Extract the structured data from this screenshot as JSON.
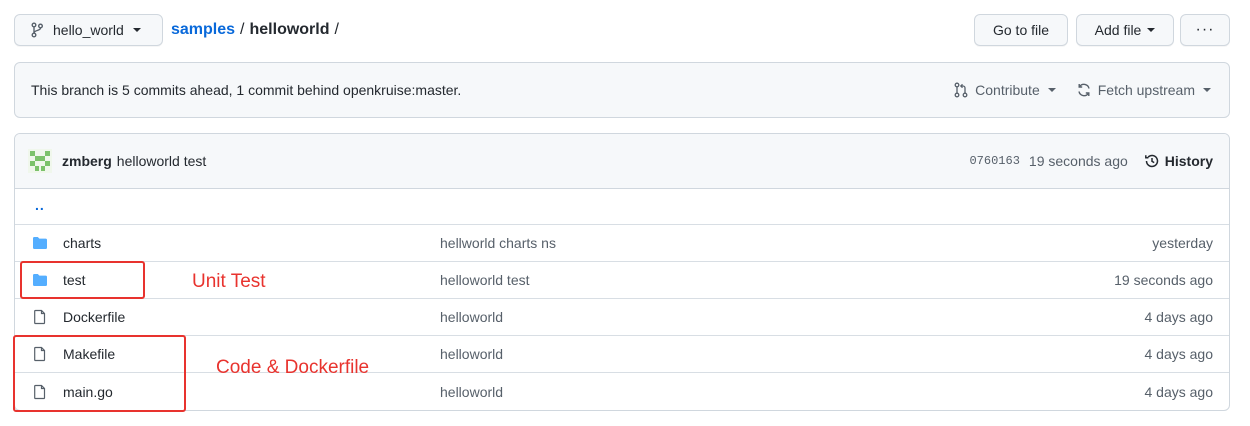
{
  "topbar": {
    "branch_name": "hello_world",
    "breadcrumb": {
      "repo_link": "samples",
      "separator": "/",
      "current": "helloworld",
      "trailing": "/"
    },
    "go_to_file": "Go to file",
    "add_file": "Add file",
    "more": "···"
  },
  "branch_status": {
    "message": "This branch is 5 commits ahead, 1 commit behind openkruise:master.",
    "contribute": "Contribute",
    "fetch_upstream": "Fetch upstream"
  },
  "latest_commit": {
    "author": "zmberg",
    "message": "helloworld test",
    "sha": "0760163",
    "time": "19 seconds ago",
    "history": "History"
  },
  "parent_dir": "..",
  "files": [
    {
      "type": "folder",
      "name": "charts",
      "message": "hellworld charts ns",
      "age": "yesterday"
    },
    {
      "type": "folder",
      "name": "test",
      "message": "helloworld test",
      "age": "19 seconds ago"
    },
    {
      "type": "file",
      "name": "Dockerfile",
      "message": "helloworld",
      "age": "4 days ago"
    },
    {
      "type": "file",
      "name": "Makefile",
      "message": "helloworld",
      "age": "4 days ago"
    },
    {
      "type": "file",
      "name": "main.go",
      "message": "helloworld",
      "age": "4 days ago"
    }
  ],
  "annotations": {
    "unit_test": "Unit Test",
    "code_dockerfile": "Code & Dockerfile"
  },
  "colors": {
    "link": "#0969da",
    "folder": "#54aeff",
    "annotation": "#e8332e",
    "border": "#d0d7de"
  }
}
